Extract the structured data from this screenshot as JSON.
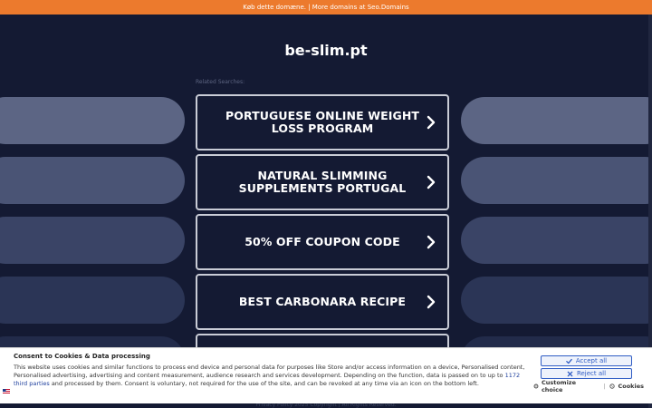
{
  "topbar": {
    "text": "Køb dette domæne. | More domains at Seo.Domains"
  },
  "site": {
    "title": "be-slim.pt",
    "related_label": "Related Searches:"
  },
  "searches": [
    {
      "label": "PORTUGUESE ONLINE WEIGHT LOSS PROGRAM"
    },
    {
      "label": "NATURAL SLIMMING SUPPLEMENTS PORTUGAL"
    },
    {
      "label": "50% OFF COUPON CODE"
    },
    {
      "label": "BEST CARBONARA RECIPE"
    },
    {
      "label": ""
    }
  ],
  "footer": {
    "text": "Privacy Policy   2025 Copyright | All Rights Reserved."
  },
  "consent": {
    "title": "Consent to Cookies & Data processing",
    "body_before_link": "This website uses cookies and similar functions to process end device and personal data for purposes like Store and/or access information on a device, Personalised content, Personalised advertising, advertising and content measurement, audience research and services development. Depending on the function, data is passed on to up to ",
    "link_text": "1172 third parties",
    "body_after_link": " and processed by them. Consent is voluntary, not required for the use of the site, and can be revoked at any time via an icon on the bottom left.",
    "accept_label": "Accept all",
    "reject_label": "Reject all",
    "customize_label": "Customize choice",
    "cookies_label": "Cookies",
    "separator": "|"
  },
  "colors": {
    "topbar": "#ec7a2d",
    "background": "#141a33",
    "accent": "#2f5cc4"
  }
}
